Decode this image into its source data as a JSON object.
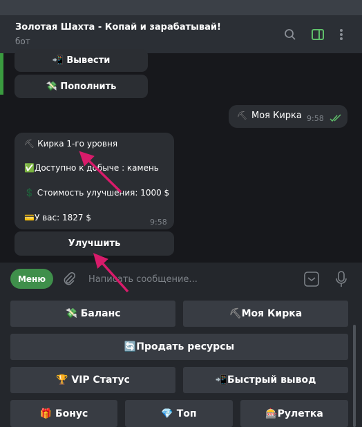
{
  "header": {
    "title": "Золотая Шахта - Копай и зарабатывай!",
    "subtitle": "бот",
    "icons": [
      "search-icon",
      "sidebar-toggle-icon",
      "more-vertical-icon"
    ],
    "accent": "#5fbf6a"
  },
  "chat": {
    "inline_buttons_top": [
      {
        "icon": "📲",
        "label": "Вывести"
      },
      {
        "icon": "💸",
        "label": "Пополнить"
      }
    ],
    "outgoing": {
      "icon": "⛏",
      "text": "Моя Кирка",
      "time": "9:58",
      "status": "read"
    },
    "incoming": {
      "lines": [
        {
          "icon": "⛏",
          "text": "Кирка 1-го уровня"
        },
        {
          "icon": "✅",
          "text": "Доступно к добыче : камень"
        },
        {
          "icon": "💲",
          "text": "Стоимость улучшения: 1000 $"
        },
        {
          "icon": "💳",
          "text": "У вас: 1827 $"
        }
      ],
      "time": "9:58"
    },
    "inline_button": "Улучшить"
  },
  "input": {
    "menu_label": "Меню",
    "placeholder": "Написать сообщение..."
  },
  "keyboard": [
    [
      {
        "icon": "💸",
        "label": "Баланс"
      },
      {
        "icon": "⛏",
        "label": "Моя Кирка"
      }
    ],
    [
      {
        "icon": "🔄",
        "label": "Продать ресурсы"
      }
    ],
    [
      {
        "icon": "🏆",
        "label": "VIP Статус"
      },
      {
        "icon": "📲",
        "label": "Быстрый вывод"
      }
    ],
    [
      {
        "icon": "🎁",
        "label": "Бонус"
      },
      {
        "icon": "💎",
        "label": "Топ"
      },
      {
        "icon": "🎰",
        "label": "Рулетка"
      }
    ]
  ],
  "annotation_color": "#d81b6a"
}
